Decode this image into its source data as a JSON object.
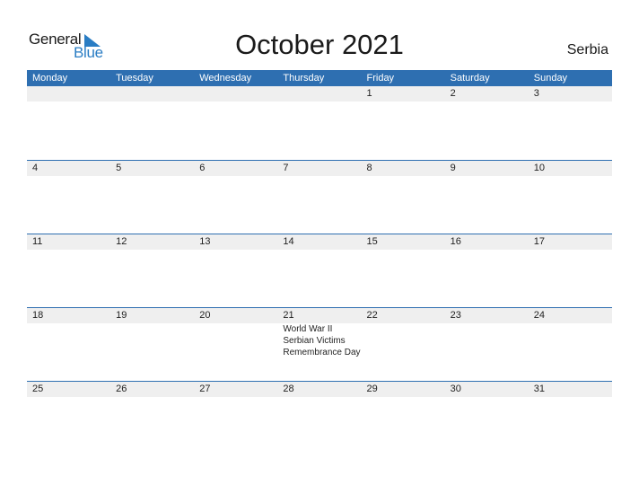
{
  "logo": {
    "line1": "General",
    "line2": "Blue"
  },
  "title": "October 2021",
  "country": "Serbia",
  "colors": {
    "header_bg": "#2e6fb1",
    "date_strip_bg": "#efefef",
    "logo_blue": "#2a7dc4"
  },
  "weekdays": [
    "Monday",
    "Tuesday",
    "Wednesday",
    "Thursday",
    "Friday",
    "Saturday",
    "Sunday"
  ],
  "weeks": [
    {
      "days": [
        "",
        "",
        "",
        "",
        "1",
        "2",
        "3"
      ],
      "events": [
        "",
        "",
        "",
        "",
        "",
        "",
        ""
      ]
    },
    {
      "days": [
        "4",
        "5",
        "6",
        "7",
        "8",
        "9",
        "10"
      ],
      "events": [
        "",
        "",
        "",
        "",
        "",
        "",
        ""
      ]
    },
    {
      "days": [
        "11",
        "12",
        "13",
        "14",
        "15",
        "16",
        "17"
      ],
      "events": [
        "",
        "",
        "",
        "",
        "",
        "",
        ""
      ]
    },
    {
      "days": [
        "18",
        "19",
        "20",
        "21",
        "22",
        "23",
        "24"
      ],
      "events": [
        "",
        "",
        "",
        "World War II Serbian Victims Remembrance Day",
        "",
        "",
        ""
      ]
    },
    {
      "days": [
        "25",
        "26",
        "27",
        "28",
        "29",
        "30",
        "31"
      ],
      "events": [
        "",
        "",
        "",
        "",
        "",
        "",
        ""
      ]
    }
  ]
}
